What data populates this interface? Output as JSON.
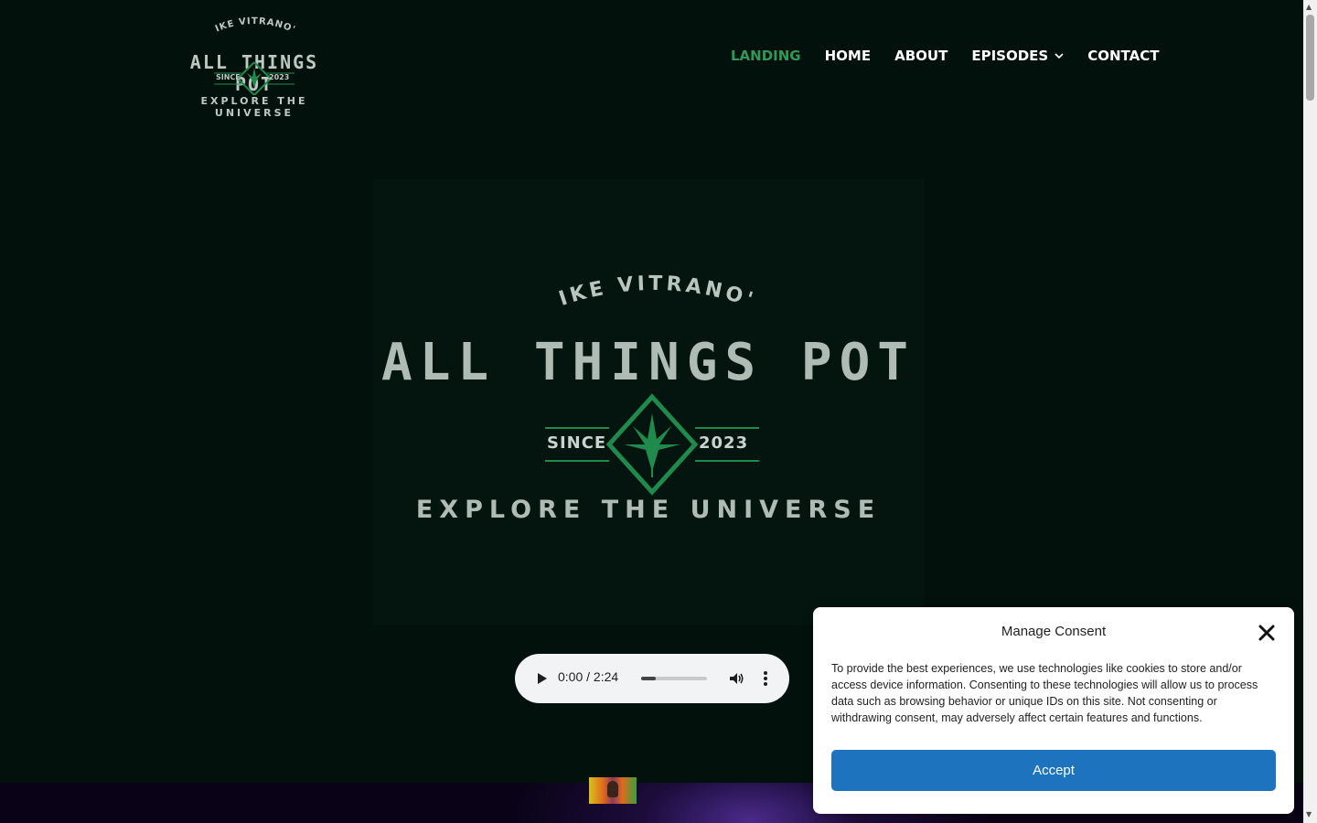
{
  "site": {
    "logo": {
      "top_text": "MIKE VITRANO'S",
      "title": "ALL THINGS POT",
      "since": "SINCE",
      "year": "2023",
      "tagline": "EXPLORE THE UNIVERSE"
    }
  },
  "nav": {
    "items": [
      {
        "label": "LANDING",
        "active": true
      },
      {
        "label": "HOME",
        "active": false
      },
      {
        "label": "ABOUT",
        "active": false
      },
      {
        "label": "EPISODES",
        "active": false,
        "has_submenu": true
      },
      {
        "label": "CONTACT",
        "active": false
      }
    ]
  },
  "hero": {
    "top_text": "MIKE VITRANO'S",
    "title": "ALL THINGS POT",
    "since": "SINCE",
    "year": "2023",
    "tagline": "EXPLORE THE UNIVERSE"
  },
  "audio": {
    "time": "0:00 / 2:24",
    "progress_fraction": 0.22,
    "icons": [
      "play-icon",
      "volume-icon",
      "more-options-icon"
    ]
  },
  "consent": {
    "title": "Manage Consent",
    "body": "To provide the best experiences, we use technologies like cookies to store and/or access device information. Consenting to these technologies will allow us to process data such as browsing behavior or unique IDs on this site. Not consenting or withdrawing consent, may adversely affect certain features and functions.",
    "accept_label": "Accept"
  },
  "colors": {
    "background": "#03110d",
    "nav_active": "#2f9a57",
    "leaf_green": "#1f8a4c",
    "accept_button": "#1e73be"
  }
}
